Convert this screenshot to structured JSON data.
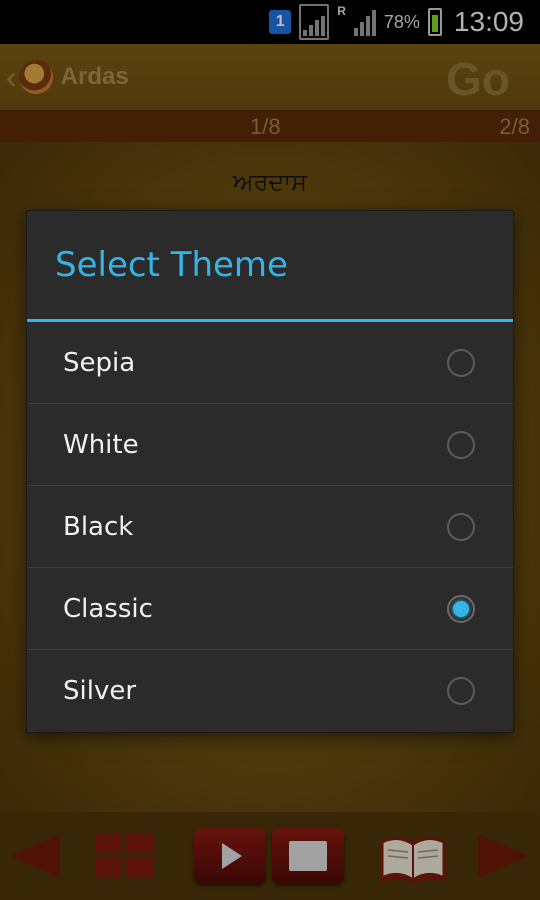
{
  "status_bar": {
    "badge": "1",
    "roaming_indicator": "R",
    "battery_percent": "78%",
    "battery_level": 0.78,
    "time": "13:09"
  },
  "header": {
    "back_icon": "chevron-left-icon",
    "title": "Ardas",
    "go_label": "Go"
  },
  "page_bar": {
    "current": "1/8",
    "next": "2/8"
  },
  "content": {
    "heading": "ਅਰਦਾਸ"
  },
  "dialog": {
    "title": "Select Theme",
    "accent_color": "#33b5e5",
    "options": [
      {
        "label": "Sepia",
        "selected": false
      },
      {
        "label": "White",
        "selected": false
      },
      {
        "label": "Black",
        "selected": false
      },
      {
        "label": "Classic",
        "selected": true
      },
      {
        "label": "Silver",
        "selected": false
      }
    ]
  },
  "toolbar": {
    "icons": [
      "prev-arrow-icon",
      "grid-icon",
      "play-icon",
      "stop-icon",
      "book-icon",
      "next-arrow-icon"
    ]
  }
}
